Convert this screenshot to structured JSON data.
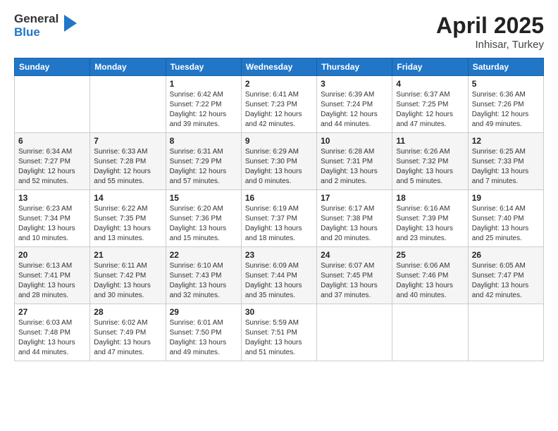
{
  "header": {
    "logo_general": "General",
    "logo_blue": "Blue",
    "title": "April 2025",
    "location": "Inhisar, Turkey"
  },
  "weekdays": [
    "Sunday",
    "Monday",
    "Tuesday",
    "Wednesday",
    "Thursday",
    "Friday",
    "Saturday"
  ],
  "weeks": [
    [
      {
        "num": "",
        "sunrise": "",
        "sunset": "",
        "daylight": ""
      },
      {
        "num": "",
        "sunrise": "",
        "sunset": "",
        "daylight": ""
      },
      {
        "num": "1",
        "sunrise": "Sunrise: 6:42 AM",
        "sunset": "Sunset: 7:22 PM",
        "daylight": "Daylight: 12 hours and 39 minutes."
      },
      {
        "num": "2",
        "sunrise": "Sunrise: 6:41 AM",
        "sunset": "Sunset: 7:23 PM",
        "daylight": "Daylight: 12 hours and 42 minutes."
      },
      {
        "num": "3",
        "sunrise": "Sunrise: 6:39 AM",
        "sunset": "Sunset: 7:24 PM",
        "daylight": "Daylight: 12 hours and 44 minutes."
      },
      {
        "num": "4",
        "sunrise": "Sunrise: 6:37 AM",
        "sunset": "Sunset: 7:25 PM",
        "daylight": "Daylight: 12 hours and 47 minutes."
      },
      {
        "num": "5",
        "sunrise": "Sunrise: 6:36 AM",
        "sunset": "Sunset: 7:26 PM",
        "daylight": "Daylight: 12 hours and 49 minutes."
      }
    ],
    [
      {
        "num": "6",
        "sunrise": "Sunrise: 6:34 AM",
        "sunset": "Sunset: 7:27 PM",
        "daylight": "Daylight: 12 hours and 52 minutes."
      },
      {
        "num": "7",
        "sunrise": "Sunrise: 6:33 AM",
        "sunset": "Sunset: 7:28 PM",
        "daylight": "Daylight: 12 hours and 55 minutes."
      },
      {
        "num": "8",
        "sunrise": "Sunrise: 6:31 AM",
        "sunset": "Sunset: 7:29 PM",
        "daylight": "Daylight: 12 hours and 57 minutes."
      },
      {
        "num": "9",
        "sunrise": "Sunrise: 6:29 AM",
        "sunset": "Sunset: 7:30 PM",
        "daylight": "Daylight: 13 hours and 0 minutes."
      },
      {
        "num": "10",
        "sunrise": "Sunrise: 6:28 AM",
        "sunset": "Sunset: 7:31 PM",
        "daylight": "Daylight: 13 hours and 2 minutes."
      },
      {
        "num": "11",
        "sunrise": "Sunrise: 6:26 AM",
        "sunset": "Sunset: 7:32 PM",
        "daylight": "Daylight: 13 hours and 5 minutes."
      },
      {
        "num": "12",
        "sunrise": "Sunrise: 6:25 AM",
        "sunset": "Sunset: 7:33 PM",
        "daylight": "Daylight: 13 hours and 7 minutes."
      }
    ],
    [
      {
        "num": "13",
        "sunrise": "Sunrise: 6:23 AM",
        "sunset": "Sunset: 7:34 PM",
        "daylight": "Daylight: 13 hours and 10 minutes."
      },
      {
        "num": "14",
        "sunrise": "Sunrise: 6:22 AM",
        "sunset": "Sunset: 7:35 PM",
        "daylight": "Daylight: 13 hours and 13 minutes."
      },
      {
        "num": "15",
        "sunrise": "Sunrise: 6:20 AM",
        "sunset": "Sunset: 7:36 PM",
        "daylight": "Daylight: 13 hours and 15 minutes."
      },
      {
        "num": "16",
        "sunrise": "Sunrise: 6:19 AM",
        "sunset": "Sunset: 7:37 PM",
        "daylight": "Daylight: 13 hours and 18 minutes."
      },
      {
        "num": "17",
        "sunrise": "Sunrise: 6:17 AM",
        "sunset": "Sunset: 7:38 PM",
        "daylight": "Daylight: 13 hours and 20 minutes."
      },
      {
        "num": "18",
        "sunrise": "Sunrise: 6:16 AM",
        "sunset": "Sunset: 7:39 PM",
        "daylight": "Daylight: 13 hours and 23 minutes."
      },
      {
        "num": "19",
        "sunrise": "Sunrise: 6:14 AM",
        "sunset": "Sunset: 7:40 PM",
        "daylight": "Daylight: 13 hours and 25 minutes."
      }
    ],
    [
      {
        "num": "20",
        "sunrise": "Sunrise: 6:13 AM",
        "sunset": "Sunset: 7:41 PM",
        "daylight": "Daylight: 13 hours and 28 minutes."
      },
      {
        "num": "21",
        "sunrise": "Sunrise: 6:11 AM",
        "sunset": "Sunset: 7:42 PM",
        "daylight": "Daylight: 13 hours and 30 minutes."
      },
      {
        "num": "22",
        "sunrise": "Sunrise: 6:10 AM",
        "sunset": "Sunset: 7:43 PM",
        "daylight": "Daylight: 13 hours and 32 minutes."
      },
      {
        "num": "23",
        "sunrise": "Sunrise: 6:09 AM",
        "sunset": "Sunset: 7:44 PM",
        "daylight": "Daylight: 13 hours and 35 minutes."
      },
      {
        "num": "24",
        "sunrise": "Sunrise: 6:07 AM",
        "sunset": "Sunset: 7:45 PM",
        "daylight": "Daylight: 13 hours and 37 minutes."
      },
      {
        "num": "25",
        "sunrise": "Sunrise: 6:06 AM",
        "sunset": "Sunset: 7:46 PM",
        "daylight": "Daylight: 13 hours and 40 minutes."
      },
      {
        "num": "26",
        "sunrise": "Sunrise: 6:05 AM",
        "sunset": "Sunset: 7:47 PM",
        "daylight": "Daylight: 13 hours and 42 minutes."
      }
    ],
    [
      {
        "num": "27",
        "sunrise": "Sunrise: 6:03 AM",
        "sunset": "Sunset: 7:48 PM",
        "daylight": "Daylight: 13 hours and 44 minutes."
      },
      {
        "num": "28",
        "sunrise": "Sunrise: 6:02 AM",
        "sunset": "Sunset: 7:49 PM",
        "daylight": "Daylight: 13 hours and 47 minutes."
      },
      {
        "num": "29",
        "sunrise": "Sunrise: 6:01 AM",
        "sunset": "Sunset: 7:50 PM",
        "daylight": "Daylight: 13 hours and 49 minutes."
      },
      {
        "num": "30",
        "sunrise": "Sunrise: 5:59 AM",
        "sunset": "Sunset: 7:51 PM",
        "daylight": "Daylight: 13 hours and 51 minutes."
      },
      {
        "num": "",
        "sunrise": "",
        "sunset": "",
        "daylight": ""
      },
      {
        "num": "",
        "sunrise": "",
        "sunset": "",
        "daylight": ""
      },
      {
        "num": "",
        "sunrise": "",
        "sunset": "",
        "daylight": ""
      }
    ]
  ]
}
